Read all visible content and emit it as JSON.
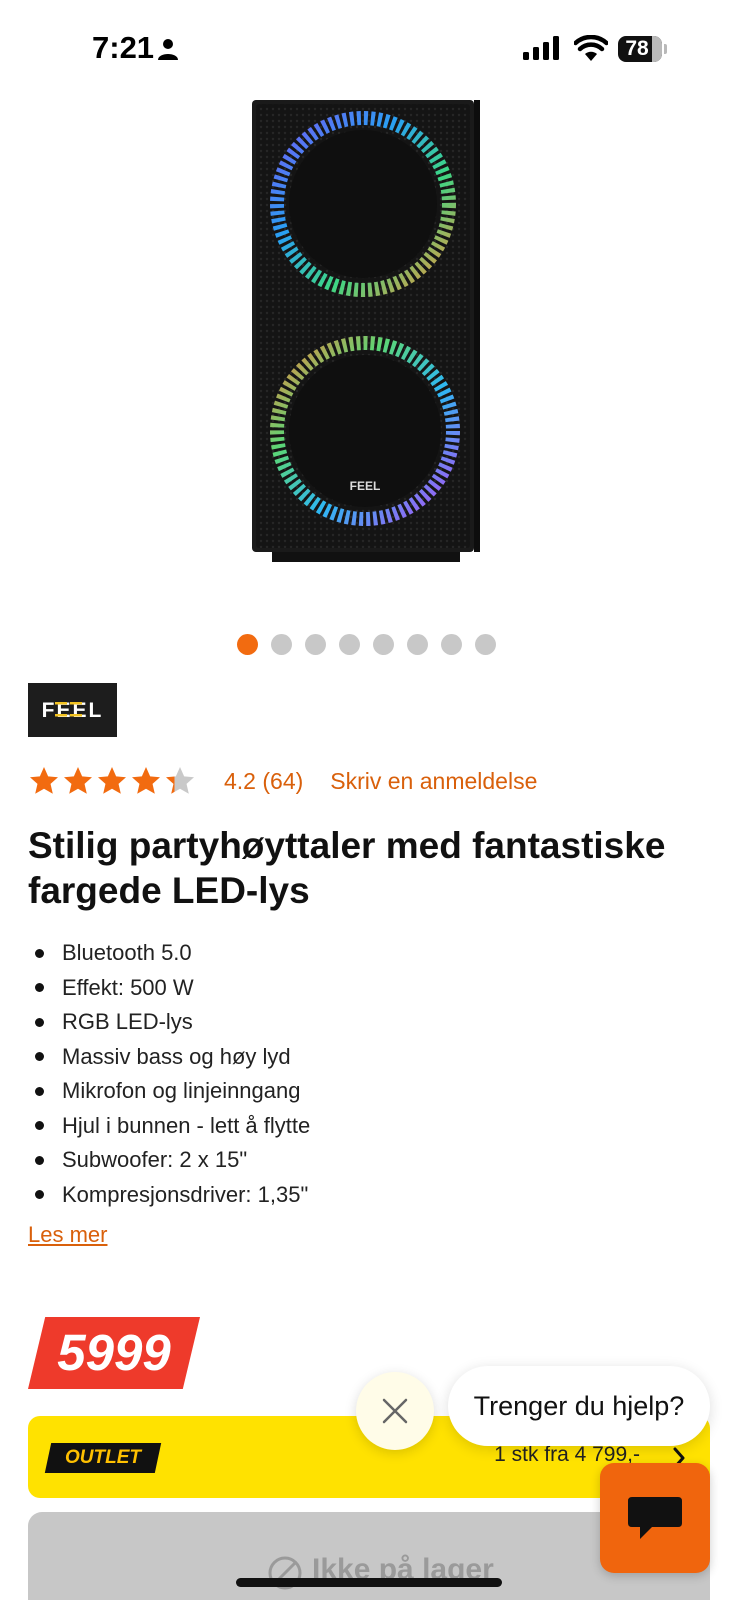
{
  "status_bar": {
    "time": "7:21",
    "battery": "78"
  },
  "product": {
    "image_alt": "Black tower party speaker with RGB LED rings",
    "carousel": {
      "total": 8,
      "active": 1
    },
    "brand": "FEEL",
    "rating": {
      "stars": 4.2,
      "text": "4.2 (64)",
      "write_review": "Skriv en anmeldelse"
    },
    "title": "Stilig partyhøyttaler med fantastiske fargede LED-lys",
    "features": [
      "Bluetooth 5.0",
      "Effekt: 500 W",
      "RGB LED-lys",
      "Massiv bass og høy lyd",
      "Mikrofon og linjeinngang",
      "Hjul i bunnen - lett å flytte",
      "Subwoofer: 2 x 15\"",
      "Kompresjonsdriver: 1,35\""
    ],
    "read_more": "Les mer",
    "price": "5999"
  },
  "outlet": {
    "badge": "OUTLET",
    "offer": "1 stk fra 4 799,-"
  },
  "stock": {
    "label": "Ikke på lager"
  },
  "chat": {
    "help_text": "Trenger du hjelp?"
  },
  "colors": {
    "accent": "#f26b10",
    "price": "#ee3a2b",
    "outlet_bg": "#ffe200"
  }
}
